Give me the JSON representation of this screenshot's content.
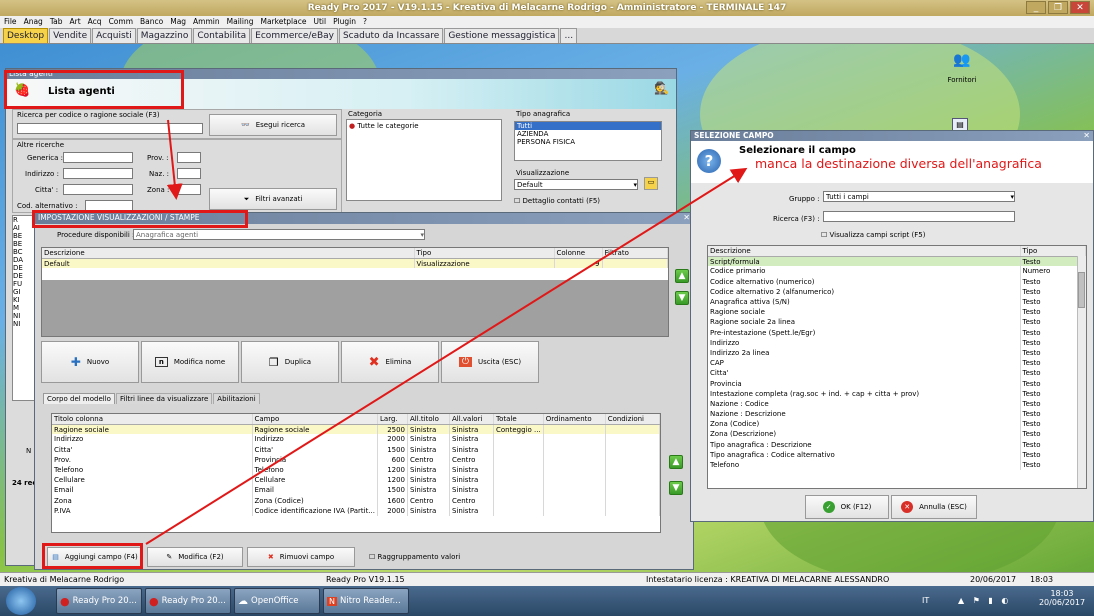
{
  "app": {
    "title": "Ready Pro 2017 - V19.1.15 - Kreativa di Melacarne Rodrigo - Amministratore - TERMINALE 147"
  },
  "menu": [
    "File",
    "Anag",
    "Tab",
    "Art",
    "Acq",
    "Comm",
    "Banco",
    "Mag",
    "Ammin",
    "Mailing",
    "Marketplace",
    "Util",
    "Plugin",
    "?"
  ],
  "tabs": [
    "Desktop",
    "Vendite",
    "Acquisti",
    "Magazzino",
    "Contabilita",
    "Ecommerce/eBay",
    "Scaduto da Incassare",
    "Gestione messaggistica",
    "..."
  ],
  "desktop": {
    "fornitori_label": "Fornitori"
  },
  "lista_agenti": {
    "window_title": "Lista agenti",
    "header": "Lista agenti",
    "search_label": "Ricerca per codice o ragione sociale (F3)",
    "search_button": "Esegui ricerca",
    "altre_ricerche": "Altre ricerche",
    "fields": {
      "generica": "Generica :",
      "indirizzo": "Indirizzo :",
      "citta": "Citta' :",
      "cod_alt": "Cod. alternativo :",
      "prov": "Prov. :",
      "naz": "Naz. :",
      "zona": "Zona :"
    },
    "filtri_button": "Filtri avanzati",
    "categoria_label": "Categoria",
    "categoria_item": "Tutte le categorie",
    "tipo_label": "Tipo anagrafica",
    "tipo_items": [
      "Tutti",
      "AZIENDA",
      "PERSONA FISICA"
    ],
    "visual_label": "Visualizzazione",
    "visual_value": "Default",
    "dettaglio_label": "Dettaglio contatti (F5)",
    "left_list": [
      "R",
      "AI",
      "BE",
      "BE",
      "BC",
      "DA",
      "DE",
      "DE",
      "FU",
      "GI",
      "KI",
      "M",
      "NI",
      "NI"
    ],
    "count_text": "24 rec",
    "n_label": "N"
  },
  "impostazione": {
    "title": "IMPOSTAZIONE VISUALIZZAZIONI / STAMPE",
    "procedure_label": "Procedure disponibili :",
    "procedure_value": "Anagrafica agenti",
    "columns": [
      "Descrizione",
      "Tipo",
      "Colonne",
      "Filtrato"
    ],
    "rows": [
      {
        "desc": "Default",
        "tipo": "Visualizzazione",
        "colonne": "9",
        "filtrato": ""
      }
    ],
    "buttons": [
      "Nuovo",
      "Modifica nome",
      "Duplica",
      "Elimina",
      "Uscita (ESC)"
    ],
    "subtabs": [
      "Corpo del modello",
      "Filtri linee da visualizzare",
      "Abilitazioni"
    ],
    "grid_columns": [
      "Titolo colonna",
      "Campo",
      "Larg.",
      "All.titolo",
      "All.valori",
      "Totale",
      "Ordinamento",
      "Condizioni"
    ],
    "grid_rows": [
      [
        "Ragione sociale",
        "Ragione sociale",
        "2500",
        "Sinistra",
        "Sinistra",
        "Conteggio ...",
        "",
        ""
      ],
      [
        "Indirizzo",
        "Indirizzo",
        "2000",
        "Sinistra",
        "Sinistra",
        "",
        "",
        ""
      ],
      [
        "Citta'",
        "Citta'",
        "1500",
        "Sinistra",
        "Sinistra",
        "",
        "",
        ""
      ],
      [
        "Prov.",
        "Provincia",
        "600",
        "Centro",
        "Centro",
        "",
        "",
        ""
      ],
      [
        "Telefono",
        "Telefono",
        "1200",
        "Sinistra",
        "Sinistra",
        "",
        "",
        ""
      ],
      [
        "Cellulare",
        "Cellulare",
        "1200",
        "Sinistra",
        "Sinistra",
        "",
        "",
        ""
      ],
      [
        "Email",
        "Email",
        "1500",
        "Sinistra",
        "Sinistra",
        "",
        "",
        ""
      ],
      [
        "Zona",
        "Zona (Codice)",
        "1600",
        "Centro",
        "Centro",
        "",
        "",
        ""
      ],
      [
        "P.IVA",
        "Codice identificazione IVA (Partit...",
        "2000",
        "Sinistra",
        "Sinistra",
        "",
        "",
        ""
      ]
    ],
    "bottom_buttons": [
      "Aggiungi campo (F4)",
      "Modifica (F2)",
      "Rimuovi campo"
    ],
    "raggruppamento": "Raggruppamento valori"
  },
  "selezione": {
    "window_title": "SELEZIONE CAMPO",
    "heading": "Selezionare il campo",
    "annotation": "manca la destinazione diversa dell'anagrafica",
    "gruppo_label": "Gruppo :",
    "gruppo_value": "Tutti i campi",
    "ricerca_label": "Ricerca (F3) :",
    "script_label": "Visualizza campi script (F5)",
    "columns": [
      "Descrizione",
      "Tipo"
    ],
    "rows": [
      [
        "Script/formula",
        "Testo"
      ],
      [
        "Codice primario",
        "Numero"
      ],
      [
        "Codice alternativo (numerico)",
        "Testo"
      ],
      [
        "Codice alternativo 2 (alfanumerico)",
        "Testo"
      ],
      [
        "Anagrafica attiva (S/N)",
        "Testo"
      ],
      [
        "Ragione sociale",
        "Testo"
      ],
      [
        "Ragione sociale 2a linea",
        "Testo"
      ],
      [
        "Pre-intestazione (Spett.le/Egr)",
        "Testo"
      ],
      [
        "Indirizzo",
        "Testo"
      ],
      [
        "Indirizzo 2a linea",
        "Testo"
      ],
      [
        "CAP",
        "Testo"
      ],
      [
        "Citta'",
        "Testo"
      ],
      [
        "Provincia",
        "Testo"
      ],
      [
        "Intestazione completa (rag.soc + ind. + cap + citta + prov)",
        "Testo"
      ],
      [
        "Nazione : Codice",
        "Testo"
      ],
      [
        "Nazione : Descrizione",
        "Testo"
      ],
      [
        "Zona (Codice)",
        "Testo"
      ],
      [
        "Zona (Descrizione)",
        "Testo"
      ],
      [
        "Tipo anagrafica : Descrizione",
        "Testo"
      ],
      [
        "Tipo anagrafica : Codice alternativo",
        "Testo"
      ],
      [
        "Telefono",
        "Testo"
      ]
    ],
    "ok_button": "OK (F12)",
    "cancel_button": "Annulla (ESC)"
  },
  "statusbar": {
    "company": "Kreativa di Melacarne Rodrigo",
    "version": "Ready Pro V19.1.15",
    "license": "Intestatario licenza : KREATIVA DI MELACARNE ALESSANDRO",
    "date": "20/06/2017",
    "time": "18:03"
  },
  "taskbar": {
    "items": [
      "Ready Pro 20...",
      "Ready Pro 20...",
      "OpenOffice",
      "Nitro Reader..."
    ],
    "lang": "IT",
    "clock_time": "18:03",
    "clock_date": "20/06/2017"
  },
  "colors": {
    "accent": "#f6d24a",
    "annotation": "#e01818",
    "title_bar": "#c0a860"
  }
}
